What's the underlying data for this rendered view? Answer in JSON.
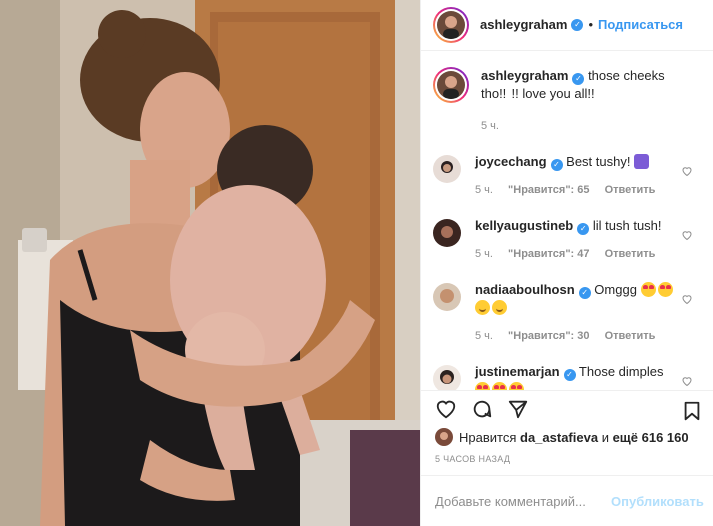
{
  "post": {
    "author": "ashleygraham",
    "follow_label": "Подписаться",
    "dot": "•",
    "caption_text": "those cheeks tho!!  !! love you all!!",
    "caption_time": "5 ч."
  },
  "comments": [
    {
      "user": "joycechang",
      "text": "Best tushy!",
      "emoji": "raised-hands",
      "time": "5 ч.",
      "likes": "\"Нравится\": 65",
      "reply": "Ответить"
    },
    {
      "user": "kellyaugustineb",
      "text": "lil tush tush!",
      "emoji": "",
      "time": "5 ч.",
      "likes": "\"Нравится\": 47",
      "reply": "Ответить"
    },
    {
      "user": "nadiaaboulhosn",
      "text": "Omggg",
      "emoji": "heart-eyes-x2 smile-x2",
      "time": "5 ч.",
      "likes": "\"Нравится\": 30",
      "reply": "Ответить"
    },
    {
      "user": "justinemarjan",
      "text": "Those dimples",
      "emoji": "heart-eyes-x3",
      "time": "",
      "likes": "",
      "reply": ""
    }
  ],
  "likes": {
    "prefix": "Нравится",
    "user": "da_astafieva",
    "middle": "и",
    "count": "ещё 616 160"
  },
  "timestamp": "5 ЧАСОВ НАЗАД",
  "composer": {
    "placeholder": "Добавьте комментарий...",
    "publish_label": "Опубликовать"
  },
  "icons": {
    "verified": "verified-badge-icon",
    "like": "heart-icon",
    "comment": "comment-icon",
    "share": "share-icon",
    "save": "bookmark-icon"
  },
  "colors": {
    "accent": "#3897f0",
    "publish_disabled": "#b2dffc",
    "meta": "#8e8e8e"
  }
}
